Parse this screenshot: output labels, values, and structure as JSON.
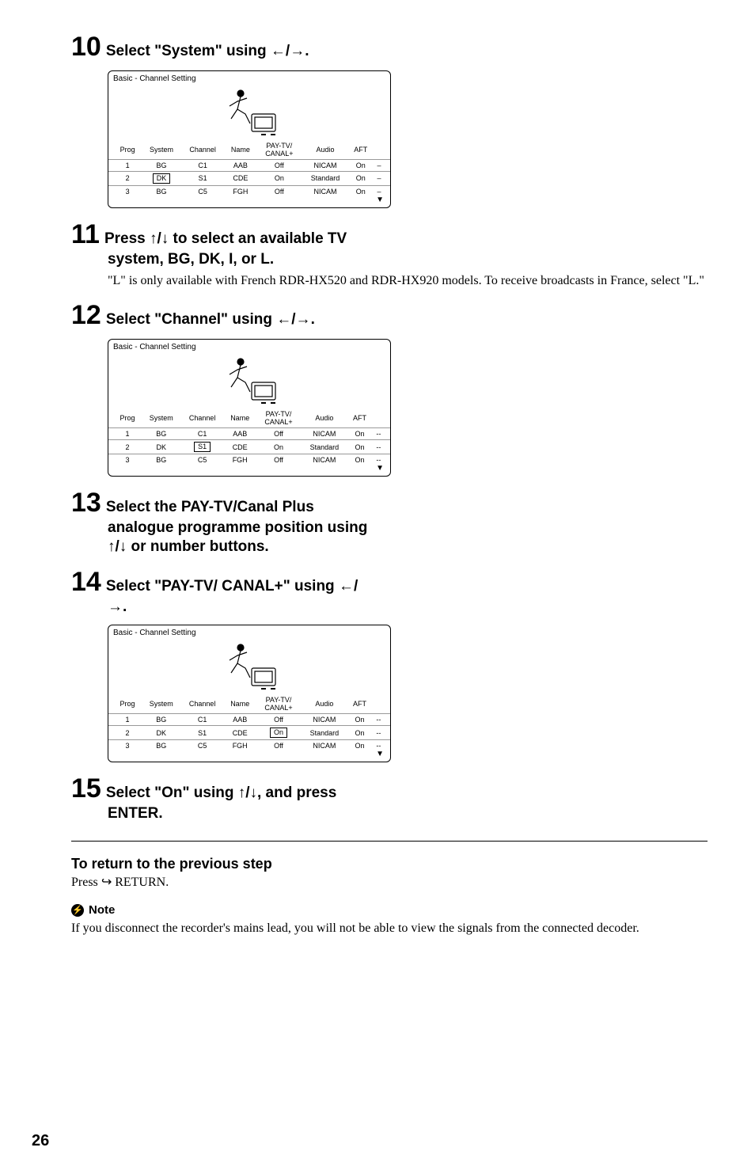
{
  "glyphs": {
    "left": "←",
    "right": "→",
    "up": "↑",
    "down": "↓",
    "upDown": "↑/↓",
    "leftRight": "←/→",
    "downTri": "▼",
    "returnArrow": "↩",
    "noteGlyph": "⚡"
  },
  "steps": {
    "s10": {
      "num": "10",
      "title_a": "Select \"System\" using ",
      "title_b": "."
    },
    "s11": {
      "num": "11",
      "title_a": "Press ",
      "title_b": " to select an available TV",
      "sub": "system, BG, DK, I, or L.",
      "body": "\"L\" is only available with French RDR-HX520 and RDR-HX920 models. To receive broadcasts in France, select \"L.\""
    },
    "s12": {
      "num": "12",
      "title_a": "Select \"Channel\" using ",
      "title_b": "."
    },
    "s13": {
      "num": "13",
      "title": "Select the PAY-TV/Canal Plus",
      "sub1": "analogue programme position using",
      "sub2_b": " or number buttons."
    },
    "s14": {
      "num": "14",
      "title_a": "Select \"PAY-TV/ CANAL+\" using ",
      "title_b": "/",
      "sub_b": "."
    },
    "s15": {
      "num": "15",
      "title_a": "Select \"On\" using ",
      "title_b": ", and press",
      "sub": "ENTER."
    }
  },
  "chart_data": [
    {
      "type": "table",
      "title": "Basic - Channel Setting",
      "columns": [
        "Prog",
        "System",
        "Channel",
        "Name",
        "PAY-TV/\nCANAL+",
        "Audio",
        "AFT",
        ""
      ],
      "rows": [
        [
          "1",
          "BG",
          "C1",
          "AAB",
          "Off",
          "NICAM",
          "On",
          "–"
        ],
        [
          "2",
          "DK",
          "S1",
          "CDE",
          "On",
          "Standard",
          "On",
          "–"
        ],
        [
          "3",
          "BG",
          "C5",
          "FGH",
          "Off",
          "NICAM",
          "On",
          "–"
        ]
      ],
      "highlight": {
        "row": 1,
        "col": 1
      },
      "last_is_dash": true
    },
    {
      "type": "table",
      "title": "Basic - Channel Setting",
      "columns": [
        "Prog",
        "System",
        "Channel",
        "Name",
        "PAY-TV/\nCANAL+",
        "Audio",
        "AFT",
        ""
      ],
      "rows": [
        [
          "1",
          "BG",
          "C1",
          "AAB",
          "Off",
          "NICAM",
          "On",
          "--"
        ],
        [
          "2",
          "DK",
          "S1",
          "CDE",
          "On",
          "Standard",
          "On",
          "--"
        ],
        [
          "3",
          "BG",
          "C5",
          "FGH",
          "Off",
          "NICAM",
          "On",
          "--"
        ]
      ],
      "highlight": {
        "row": 1,
        "col": 2
      },
      "last_is_dash": false
    },
    {
      "type": "table",
      "title": "Basic - Channel Setting",
      "columns": [
        "Prog",
        "System",
        "Channel",
        "Name",
        "PAY-TV/\nCANAL+",
        "Audio",
        "AFT",
        ""
      ],
      "rows": [
        [
          "1",
          "BG",
          "C1",
          "AAB",
          "Off",
          "NICAM",
          "On",
          "--"
        ],
        [
          "2",
          "DK",
          "S1",
          "CDE",
          "On",
          "Standard",
          "On",
          "--"
        ],
        [
          "3",
          "BG",
          "C5",
          "FGH",
          "Off",
          "NICAM",
          "On",
          "--"
        ]
      ],
      "highlight": {
        "row": 1,
        "col": 4
      },
      "last_is_dash": false
    }
  ],
  "footer": {
    "returnHead": "To return to the previous step",
    "return_a": "Press ",
    "return_b": " RETURN.",
    "noteLabel": "Note",
    "noteBody": "If you disconnect the recorder's mains lead, you will not be able to view the signals from the connected decoder."
  },
  "pageNumber": "26"
}
